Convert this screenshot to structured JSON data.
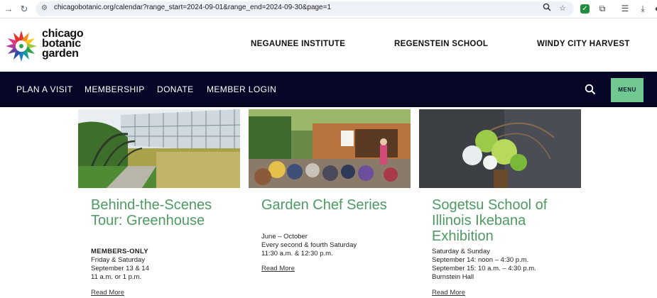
{
  "browser": {
    "url": "chicagobotanic.org/calendar?range_start=2024-09-01&range_end=2024-09-30&page=1"
  },
  "header": {
    "logo_lines": [
      "chicago",
      "botanic",
      "garden"
    ],
    "top_links": [
      "NEGAUNEE INSTITUTE",
      "REGENSTEIN SCHOOL",
      "WINDY CITY HARVEST"
    ]
  },
  "nav": {
    "items": [
      "PLAN A VISIT",
      "MEMBERSHIP",
      "DONATE",
      "MEMBER LOGIN"
    ],
    "menu_label": "MENU"
  },
  "cards": [
    {
      "title": "Behind-the-Scenes Tour: Greenhouse",
      "label": "MEMBERS-ONLY",
      "lines": [
        "Friday & Saturday",
        "September 13 & 14",
        "11 a.m. or 1 p.m."
      ],
      "read_more": "Read More"
    },
    {
      "title": "Garden Chef Series",
      "lines": [
        "June – October",
        "Every second & fourth Saturday",
        "11:30 a.m. & 12:30 p.m."
      ],
      "read_more": "Read More"
    },
    {
      "title": "Sogetsu School of Illinois Ikebana Exhibition",
      "lines": [
        "Saturday & Sunday",
        "September 14: noon – 4:30 p.m.",
        "September 15: 10 a.m. – 4:30 p.m.",
        "Burnstein Hall"
      ],
      "read_more": "Read More"
    }
  ],
  "colors": {
    "nav_bg": "#060627",
    "menu_btn": "#72c892",
    "title_green": "#4f9a62"
  }
}
